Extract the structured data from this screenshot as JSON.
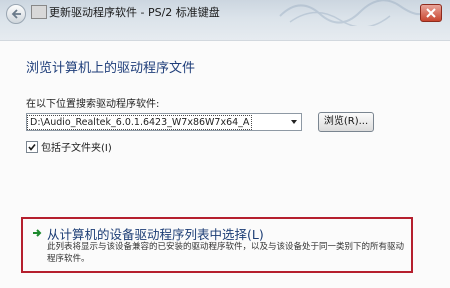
{
  "window": {
    "title": "更新驱动程序软件 - PS/2 标准键盘",
    "accent": "#1f3e7a",
    "highlight_border": "#b51f2e"
  },
  "main": {
    "heading": "浏览计算机上的驱动程序文件",
    "search_label": "在以下位置搜索驱动程序软件:",
    "path_value": "D:\\Audio_Realtek_6.0.1.6423_W7x86W7x64_A",
    "browse_label": "浏览(R)...",
    "include_subfolders": {
      "label": "包括子文件夹(I)",
      "checked": true
    }
  },
  "option": {
    "title": "从计算机的设备驱动程序列表中选择(L)",
    "description": "此列表将显示与该设备兼容的已安装的驱动程序软件，以及与该设备处于同一类别下的所有驱动程序软件。"
  },
  "icons": [
    "back-arrow-icon",
    "device-icon",
    "close-icon",
    "chevron-down-icon",
    "checkmark-icon",
    "green-arrow-icon"
  ]
}
